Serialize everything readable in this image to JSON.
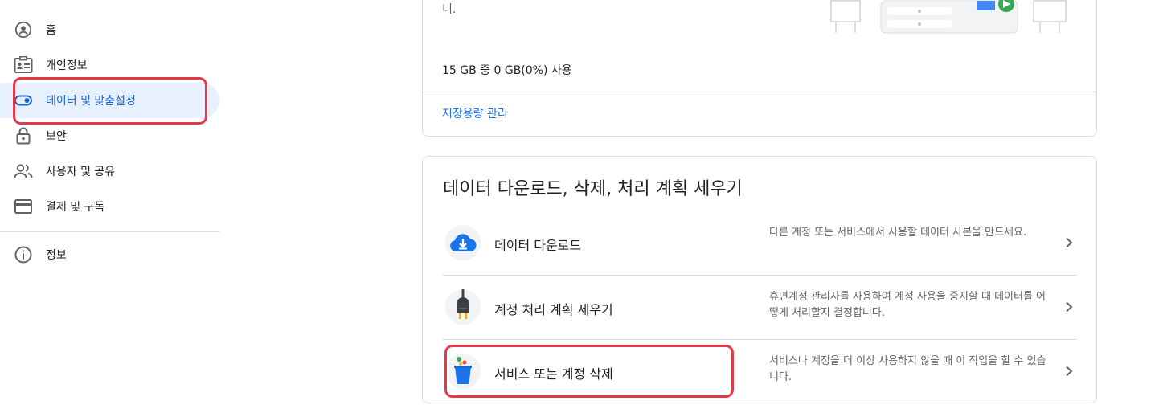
{
  "sidebar": {
    "items": [
      {
        "label": "홈",
        "icon": "account-circle-icon"
      },
      {
        "label": "개인정보",
        "icon": "id-card-icon"
      },
      {
        "label": "데이터 및 맞춤설정",
        "icon": "toggle-icon",
        "active": true
      },
      {
        "label": "보안",
        "icon": "lock-icon"
      },
      {
        "label": "사용자 및 공유",
        "icon": "people-icon"
      },
      {
        "label": "결제 및 구독",
        "icon": "credit-card-icon"
      },
      {
        "label": "정보",
        "icon": "info-icon"
      }
    ]
  },
  "storage": {
    "tail_text": "니.",
    "usage": "15 GB 중 0 GB(0%) 사용",
    "manage_link": "저장용량 관리"
  },
  "data_section": {
    "title": "데이터 다운로드, 삭제, 처리 계획 세우기",
    "rows": [
      {
        "title": "데이터 다운로드",
        "desc": "다른 계정 또는 서비스에서 사용할 데이터 사본을 만드세요.",
        "icon": "cloud-download-icon"
      },
      {
        "title": "계정 처리 계획 세우기",
        "desc": "휴면계정 관리자를 사용하여 계정 사용을 중지할 때 데이터를 어떻게 처리할지 결정합니다.",
        "icon": "plug-icon"
      },
      {
        "title": "서비스 또는 계정 삭제",
        "desc": "서비스나 계정을 더 이상 사용하지 않을 때 이 작업을 할 수 있습니다.",
        "icon": "trash-bin-icon"
      }
    ]
  },
  "colors": {
    "accent": "#1a73e8",
    "active_bg": "#e8f0fe",
    "highlight": "#e53945",
    "divider": "#dadce0"
  }
}
